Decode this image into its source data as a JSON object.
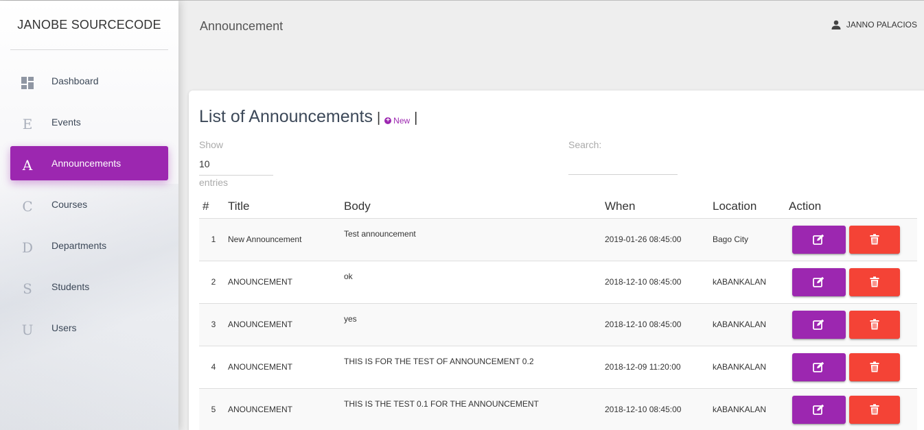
{
  "sidebar": {
    "brand": "JANOBE SOURCECODE",
    "items": [
      {
        "icon": "dashboard-icon",
        "glyph": "",
        "label": "Dashboard",
        "active": false
      },
      {
        "icon": "letter-e-icon",
        "glyph": "E",
        "label": "Events",
        "active": false
      },
      {
        "icon": "letter-a-icon",
        "glyph": "A",
        "label": "Announcements",
        "active": true
      },
      {
        "icon": "letter-c-icon",
        "glyph": "C",
        "label": "Courses",
        "active": false
      },
      {
        "icon": "letter-d-icon",
        "glyph": "D",
        "label": "Departments",
        "active": false
      },
      {
        "icon": "letter-s-icon",
        "glyph": "S",
        "label": "Students",
        "active": false
      },
      {
        "icon": "letter-u-icon",
        "glyph": "U",
        "label": "Users",
        "active": false
      }
    ]
  },
  "header": {
    "title": "Announcement",
    "user_name": "JANNO PALACIOS"
  },
  "card": {
    "title": "List of Announcements",
    "new_label": "New",
    "show_label": "Show",
    "show_value": "10",
    "entries_label": "entries",
    "search_label": "Search:",
    "search_value": ""
  },
  "table": {
    "columns": [
      "#",
      "Title",
      "Body",
      "When",
      "Location",
      "Action"
    ],
    "rows": [
      {
        "num": "1",
        "title": "New Announcement",
        "body": "Test announcement",
        "when": "2019-01-26 08:45:00",
        "location": "Bago City"
      },
      {
        "num": "2",
        "title": "ANOUNCEMENT",
        "body": "ok",
        "when": "2018-12-10 08:45:00",
        "location": "kABANKALAN"
      },
      {
        "num": "3",
        "title": "ANOUNCEMENT",
        "body": "yes",
        "when": "2018-12-10 08:45:00",
        "location": "kABANKALAN"
      },
      {
        "num": "4",
        "title": "ANOUNCEMENT",
        "body": "THIS IS FOR THE TEST OF ANNOUNCEMENT 0.2",
        "when": "2018-12-09 11:20:00",
        "location": "kABANKALAN"
      },
      {
        "num": "5",
        "title": "ANOUNCEMENT",
        "body": "THIS IS THE TEST 0.1 FOR THE ANNOUNCEMENT",
        "when": "2018-12-10 08:45:00",
        "location": "kABANKALAN"
      }
    ]
  },
  "colors": {
    "accent": "#9c27b0",
    "danger": "#f44336"
  }
}
